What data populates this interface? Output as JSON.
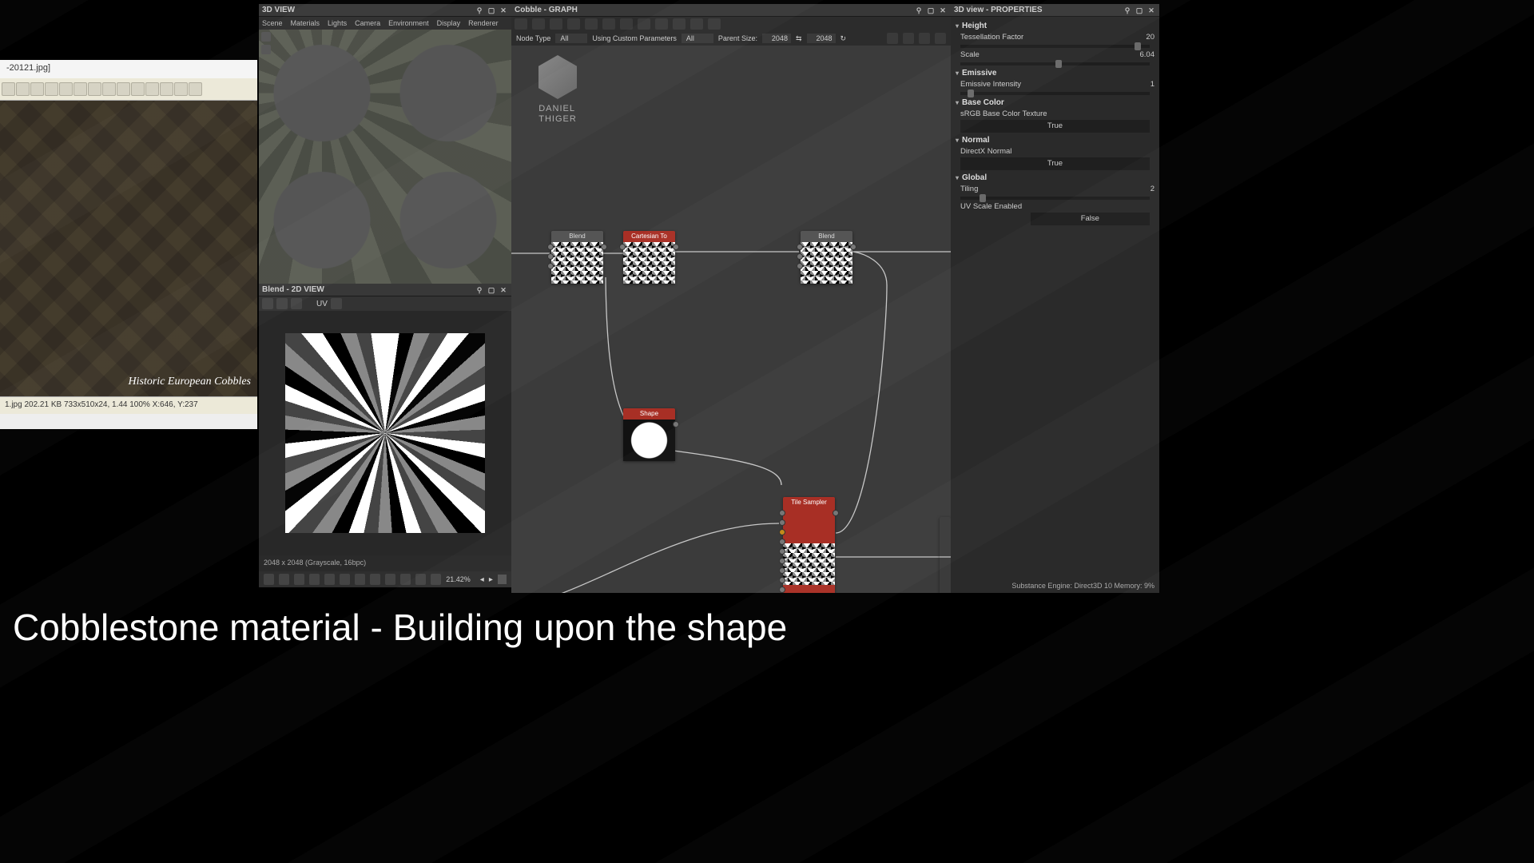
{
  "imgviewer": {
    "tab": "1.jpg  202.21 KB  733x510x24, 1.44  100%  X:646, Y:237",
    "file_tab": "-20121.jpg]",
    "photo_caption": "Historic European Cobbles",
    "status": "1.jpg  202.21 KB  733x510x24, 1.44  100%  X:646, Y:237"
  },
  "view3d": {
    "title": "3D VIEW",
    "menu": [
      "Scene",
      "Materials",
      "Lights",
      "Camera",
      "Environment",
      "Display",
      "Renderer"
    ]
  },
  "view2d": {
    "title": "Blend - 2D VIEW",
    "uv_label": "UV",
    "info": "2048 x 2048 (Grayscale, 16bpc)",
    "zoom": "21.42%"
  },
  "graph": {
    "title": "Cobble - GRAPH",
    "filters": {
      "node_type_label": "Node Type",
      "node_type_value": "All",
      "custom_params_label": "Using Custom Parameters",
      "custom_params_value": "All",
      "parent_size_label": "Parent Size:",
      "parent_w": "2048",
      "parent_h": "2048"
    },
    "logo_text_1": "DANIEL",
    "logo_text_2": "THIGER",
    "nodes": {
      "blend1": "Blend",
      "cart": "Cartesian To Pol...",
      "blend2": "Blend",
      "shape": "Shape",
      "tilesampler": "Tile Sampler"
    }
  },
  "props": {
    "title": "3D view - PROPERTIES",
    "height_section": "Height",
    "tess_label": "Tessellation Factor",
    "tess_val": "20",
    "scale_label": "Scale",
    "scale_val": "6.04",
    "emissive_section": "Emissive",
    "emissive_label": "Emissive Intensity",
    "emissive_val": "1",
    "basecolor_section": "Base Color",
    "basecolor_label": "sRGB Base Color Texture",
    "basecolor_val": "True",
    "normal_section": "Normal",
    "normal_label": "DirectX Normal",
    "normal_val": "True",
    "global_section": "Global",
    "tiling_label": "Tiling",
    "tiling_val": "2",
    "uvscale_label": "UV Scale Enabled",
    "uvscale_val": "False",
    "footer": "Substance Engine: Direct3D 10   Memory: 9%"
  },
  "caption": "Cobblestone material - Building upon the shape"
}
